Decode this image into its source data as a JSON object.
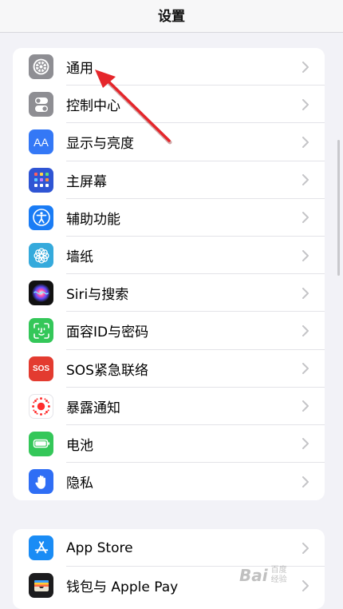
{
  "nav": {
    "title": "设置"
  },
  "group1": [
    {
      "label": "通用",
      "icon": "gear-icon",
      "color": "#8e8e93"
    },
    {
      "label": "控制中心",
      "icon": "control-center-icon",
      "color": "#8e8e93"
    },
    {
      "label": "显示与亮度",
      "icon": "display-brightness-icon",
      "color": "#3478f6"
    },
    {
      "label": "主屏幕",
      "icon": "home-screen-icon",
      "color": "#2f55d4"
    },
    {
      "label": "辅助功能",
      "icon": "accessibility-icon",
      "color": "#1a7cf5"
    },
    {
      "label": "墙纸",
      "icon": "wallpaper-icon",
      "color": "#35aadc"
    },
    {
      "label": "Siri与搜索",
      "icon": "siri-icon",
      "color": "#111111"
    },
    {
      "label": "面容ID与密码",
      "icon": "face-id-icon",
      "color": "#34c759"
    },
    {
      "label": "SOS紧急联络",
      "icon": "sos-icon",
      "color": "#e33b30"
    },
    {
      "label": "暴露通知",
      "icon": "exposure-notification-icon",
      "color": "#ffffff"
    },
    {
      "label": "电池",
      "icon": "battery-icon",
      "color": "#34c759"
    },
    {
      "label": "隐私",
      "icon": "privacy-hand-icon",
      "color": "#2f6ef5"
    }
  ],
  "group2": [
    {
      "label": "App Store",
      "icon": "app-store-icon",
      "color": "#1a8cf5"
    },
    {
      "label": "钱包与 Apple Pay",
      "icon": "wallet-icon",
      "color": "#1c1c1e"
    }
  ],
  "icon_text": {
    "aa": "AA",
    "sos": "SOS"
  },
  "watermark": {
    "brand": "Bai",
    "sub1": "百度",
    "sub2": "经验"
  },
  "colors": {
    "background": "#f2f2f7",
    "annotation_arrow": "#e5262b"
  }
}
